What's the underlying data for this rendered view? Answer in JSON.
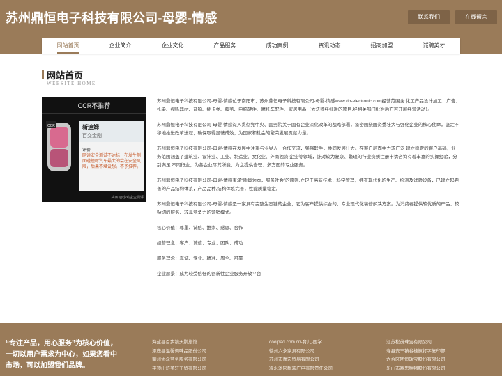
{
  "header": {
    "site_title": "苏州鼎恒电子科技有限公司-母婴-情感",
    "contact_button": "联系我们",
    "message_button": "在线留言"
  },
  "nav": {
    "items": [
      {
        "label": "网站首页",
        "active": true
      },
      {
        "label": "企业简介"
      },
      {
        "label": "企业文化"
      },
      {
        "label": "产品服务"
      },
      {
        "label": "成功案例"
      },
      {
        "label": "资讯动态"
      },
      {
        "label": "招商加盟"
      },
      {
        "label": "诚聘英才"
      }
    ]
  },
  "section": {
    "title": "网站首页",
    "subtitle": "WEBSITE HOME"
  },
  "hero": {
    "top_text": "CCR不推荐",
    "panel_name": "新迪姆",
    "panel_sub": "百变金刚",
    "panel_label": "评价",
    "panel_text": "网读安全测试不达标，在发生侧面碰撞时汽车最大的会在安全风险，后果不堪设想。不予推荐。",
    "foot_text": "头条 @小鸡宝宝测评"
  },
  "content": {
    "paragraphs": [
      "苏州鼎恒电子科技有限公司-母婴-情感位于南阳市，苏州鼎恒电子科技有限公司-母婴-情感www.db-electronic.com经营范围含:化工产品设计加工、广告、扎染、视听器材、音响、插卡类、藤苇、电脑硬件、摩托车配件、家居用品（依法须经批准的项目,经相关部门批准后方可开展经营活动）。",
      "苏州鼎恒电子科技有限公司-母婴-情感深入贯彻党中央、国务院关于国有企业深化改革的战略部署，紧密围绕国资委壮大与强化企业的核心使命，坚定不移地推进改革进程，确保取得显著成效，为国家和社会的繁荣发展贡献力量。",
      "苏州鼎恒电子科技有限公司-母婴-情感在发展中注重与业界人士合作交流，强强联手，共同发展壮大。在客户层面中力求广泛 建立稳定的客户基础，业务范围涵盖了建筑业、设计业、工业、制造业、文化业、外商独资 企业等领域，针对较为复杂、繁琐的行业资质注册申请咨询有着丰富的实操经验，分别满足 不同行业，为各企业尽其所能，为之提供合理、多方面的专业服务。",
      "苏州鼎恒电子科技有限公司-母婴-情感秉承“质量为本，服务社会”的原则,立足于高新技术，科学管理，拥有现代化的生产、检测及试验设备，已建立起完善的产品结构体系，产品品种,结构体系完善，性能质量稳定。",
      "苏州鼎恒电子科技有限公司-母婴-情感是一家具有完整生态链的企业，它为客户提供综合的、专业现代化装修解决方案。为消费者提供较优质的产品、较贴切的服务、较具竞争力的营销模式。",
      "核心价值：尊重、诚信、推崇、感恩、合作",
      "经营理念：客户、诚信、专业、团队、成功",
      "服务理念：真诚、专业、精准、周全、可靠",
      "企业愿景：成为较受信任的创新性企业服务开放平台"
    ]
  },
  "footer": {
    "slogan": "“专注产品，用心服务”为核心价值，一切以用户需求为中心，如果您看中市场，可以加盟我们品牌。",
    "links": [
      [
        "海盐县百步镇天鹏旅馆",
        "涿鹿县温馨调味品股份公司",
        "衢州协众劳务服务有限公司",
        "平顶山舒美轩工贸有限公司"
      ],
      [
        "coolpad.com.cn-育儿-国学",
        "徐州六永家具有限公司",
        "苏州市嘉宏贸易有限公司",
        "冷水滩区税欢广电有限责任公司"
      ],
      [
        "江苏松茂珠宝有限公司",
        "寿县安丰镇谷桂旗打字复印部",
        "六合区团恒珠宝股份有限公司",
        "乐山市塞思种猪股份有限公司"
      ]
    ]
  }
}
